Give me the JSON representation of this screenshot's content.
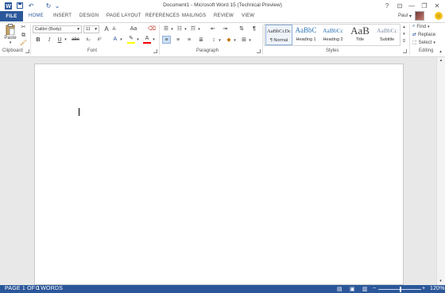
{
  "window": {
    "title": "Document1 - Microsoft Word 15 (Technical Preview)",
    "controls": [
      "?",
      "⊡",
      "—",
      "❐",
      "✕"
    ]
  },
  "qat": {
    "save": "💾",
    "undo": "↶",
    "redo": "↻",
    "customize": "⌄"
  },
  "tabs": [
    {
      "label": "FILE"
    },
    {
      "label": "HOME"
    },
    {
      "label": "INSERT"
    },
    {
      "label": "DESIGN"
    },
    {
      "label": "PAGE LAYOUT"
    },
    {
      "label": "REFERENCES"
    },
    {
      "label": "MAILINGS"
    },
    {
      "label": "REVIEW"
    },
    {
      "label": "VIEW"
    }
  ],
  "user": {
    "name": "Paul",
    "menu_caret": "▾"
  },
  "clipboard": {
    "paste_label": "Paste",
    "group_label": "Clipboard"
  },
  "font": {
    "name": "Calibri (Body)",
    "size": "11",
    "grow": "A",
    "shrink": "A",
    "case": "Aa",
    "bold": "B",
    "italic": "I",
    "underline": "U",
    "strike": "abc",
    "subscript": "x₂",
    "superscript": "x²",
    "group_label": "Font"
  },
  "paragraph": {
    "group_label": "Paragraph",
    "pilcrow": "¶"
  },
  "styles": {
    "group_label": "Styles",
    "items": [
      {
        "preview": "AaBbCcDc",
        "name": "¶ Normal"
      },
      {
        "preview": "AaBbC",
        "name": "Heading 1"
      },
      {
        "preview": "AaBbCc",
        "name": "Heading 2"
      },
      {
        "preview": "AaB",
        "name": "Title"
      },
      {
        "preview": "AaBbCc",
        "name": "Subtitle"
      }
    ],
    "colors": {
      "heading": "#2e74b5",
      "title": "#404040",
      "subtitle": "#7f8fa6"
    }
  },
  "editing": {
    "find": "Find",
    "replace": "Replace",
    "select": "Select",
    "group_label": "Editing"
  },
  "status": {
    "page": "PAGE 1 OF 1",
    "words": "0 WORDS",
    "zoom": "120%",
    "minus": "−",
    "plus": "+"
  },
  "colors": {
    "accent": "#2b579a",
    "highlight": "#ffff00",
    "font_color": "#ff0000"
  }
}
